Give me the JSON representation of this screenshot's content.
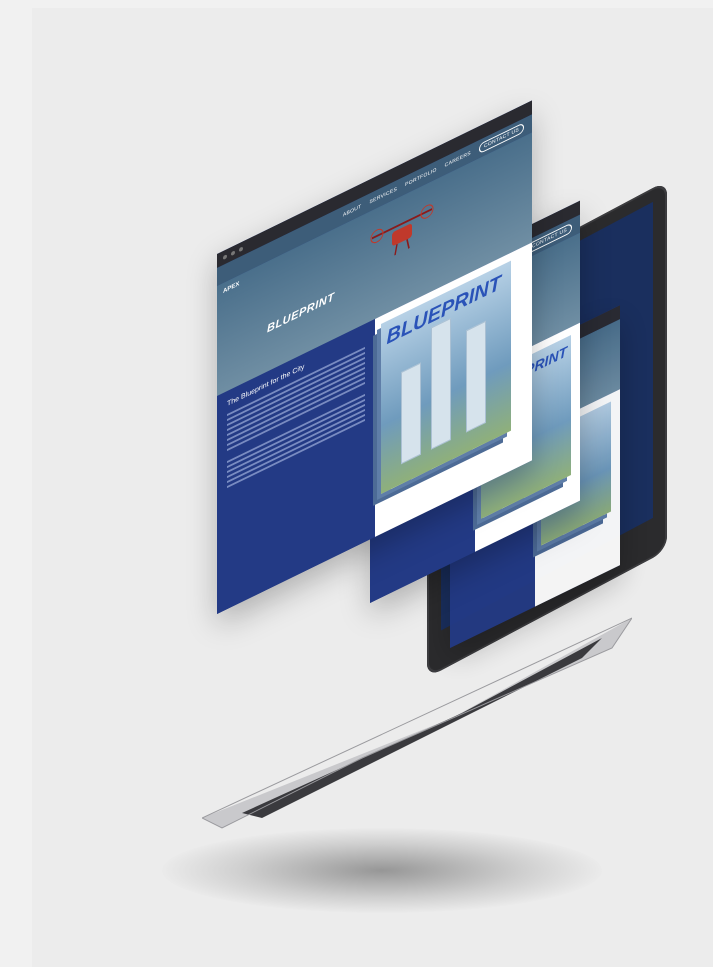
{
  "site": {
    "logo": "APEX",
    "nav": [
      "ABOUT",
      "SERVICES",
      "PORTFOLIO",
      "CAREERS"
    ],
    "contact_button": "CONTACT US",
    "brand": "BLUEPRINT",
    "headline": "The Blueprint for the City",
    "magazine_title": "BLUEPRINT"
  },
  "colors": {
    "navy": "#233a85",
    "sky": "#4a6f8b",
    "drone": "#c0392b",
    "laptop": "#2b2b2d",
    "background": "#ececec"
  }
}
